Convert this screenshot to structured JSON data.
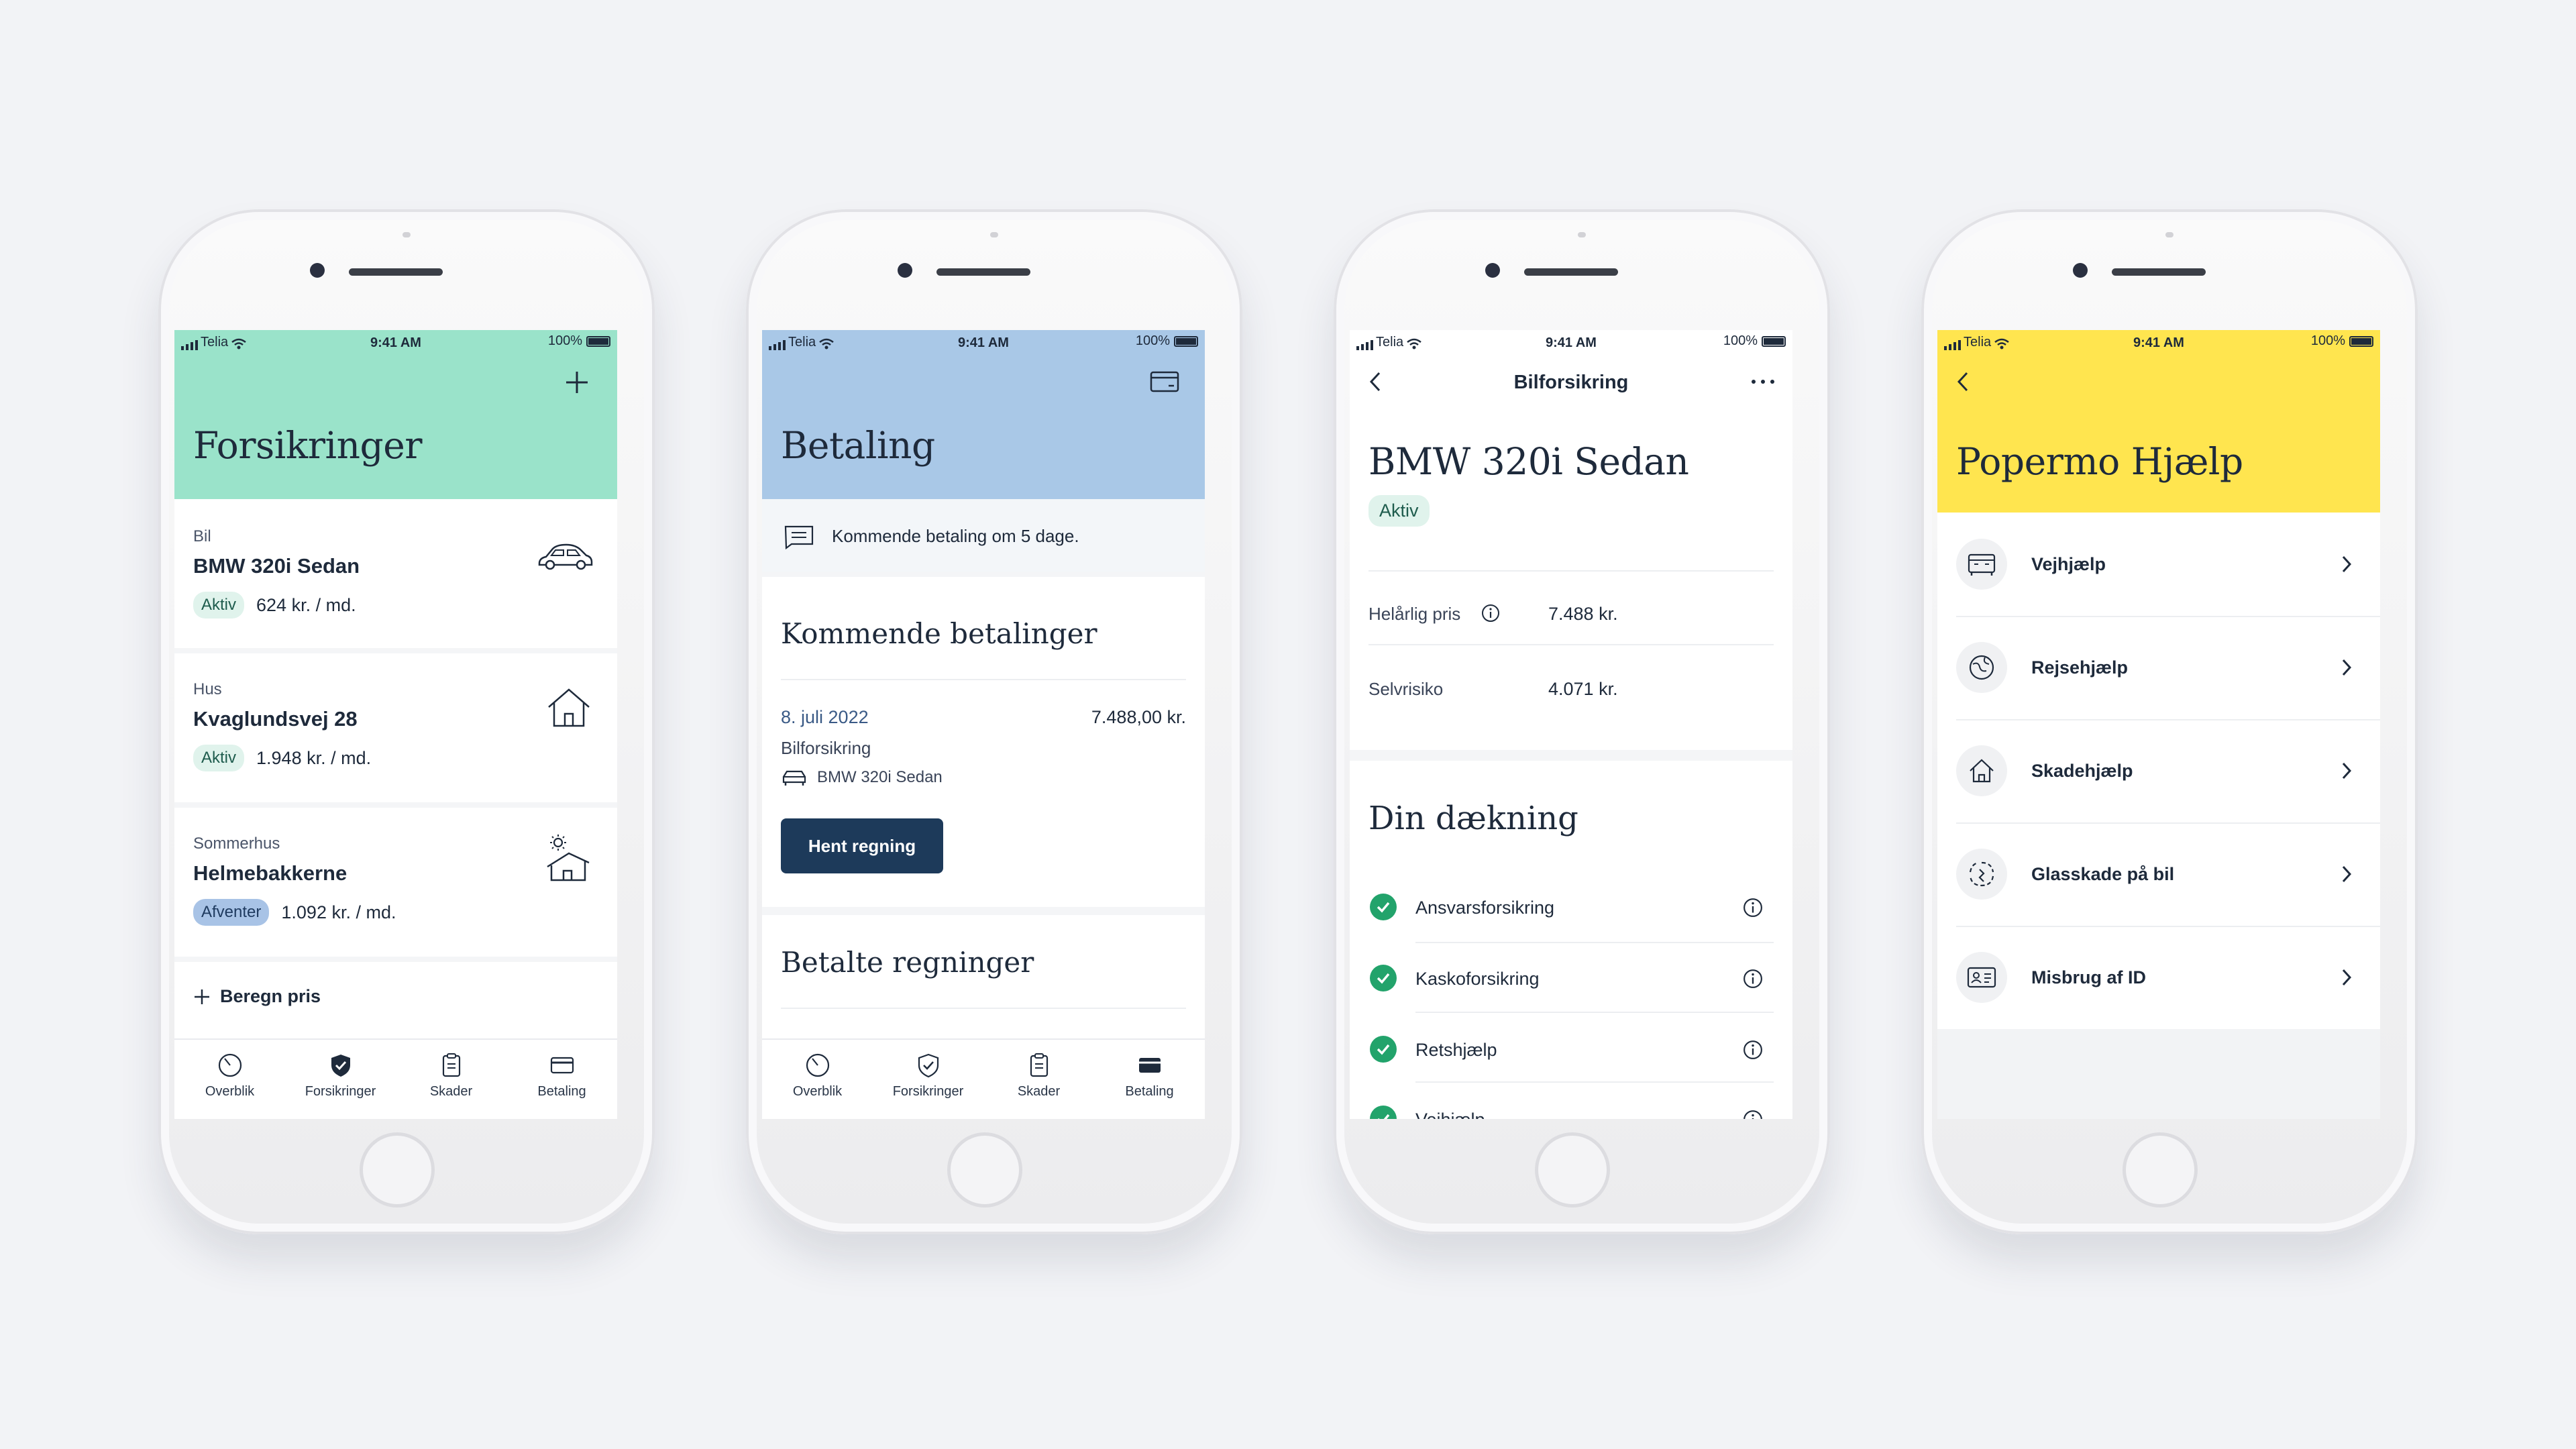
{
  "colors": {
    "background": "#f2f3f6",
    "mint": "#9ae3ca",
    "blue": "#a9c8e7",
    "yellow": "#ffe54f",
    "dark_button": "#1d3a5a",
    "check": "#22a36b"
  },
  "status_bar": {
    "carrier": "Telia",
    "time": "9:41 AM",
    "battery": "100%"
  },
  "phone1": {
    "title": "Forsikringer",
    "add_icon": "plus-icon",
    "items": [
      {
        "type": "Bil",
        "name": "BMW 320i Sedan",
        "status": "Aktiv",
        "price": "624 kr. / md.",
        "icon": "car-icon"
      },
      {
        "type": "Hus",
        "name": "Kvaglundsvej 28",
        "status": "Aktiv",
        "price": "1.948 kr. / md.",
        "icon": "house-icon"
      },
      {
        "type": "Sommerhus",
        "name": "Helmebakkerne",
        "status": "Afventer",
        "price": "1.092 kr. / md.",
        "icon": "summerhouse-icon"
      }
    ],
    "calc_link": "Beregn pris"
  },
  "tabs": [
    {
      "label": "Overblik",
      "icon": "overview-icon"
    },
    {
      "label": "Forsikringer",
      "icon": "shield-icon"
    },
    {
      "label": "Skader",
      "icon": "clipboard-icon"
    },
    {
      "label": "Betaling",
      "icon": "card-icon"
    }
  ],
  "phone2": {
    "title": "Betaling",
    "notice": "Kommende betaling om 5 dage.",
    "upcoming_title": "Kommende betalinger",
    "payment": {
      "date": "8. juli 2022",
      "amount": "7.488,00 kr.",
      "type": "Bilforsikring",
      "car": "BMW 320i Sedan"
    },
    "button": "Hent regning",
    "paid_title": "Betalte regninger"
  },
  "phone3": {
    "nav_title": "Bilforsikring",
    "title": "BMW 320i Sedan",
    "status": "Aktiv",
    "rows": [
      {
        "label": "Helårlig pris",
        "value": "7.488 kr."
      },
      {
        "label": "Selvrisiko",
        "value": "4.071 kr."
      }
    ],
    "coverage_title": "Din dækning",
    "coverage": [
      "Ansvarsforsikring",
      "Kaskoforsikring",
      "Retshjælp",
      "Vejhjælp"
    ]
  },
  "phone4": {
    "title": "Popermo Hjælp",
    "items": [
      {
        "label": "Vejhjælp",
        "icon": "roadside-icon"
      },
      {
        "label": "Rejsehjælp",
        "icon": "globe-icon"
      },
      {
        "label": "Skadehjælp",
        "icon": "house-icon"
      },
      {
        "label": "Glasskade på bil",
        "icon": "broken-glass-icon"
      },
      {
        "label": "Misbrug af ID",
        "icon": "id-card-icon"
      }
    ]
  }
}
